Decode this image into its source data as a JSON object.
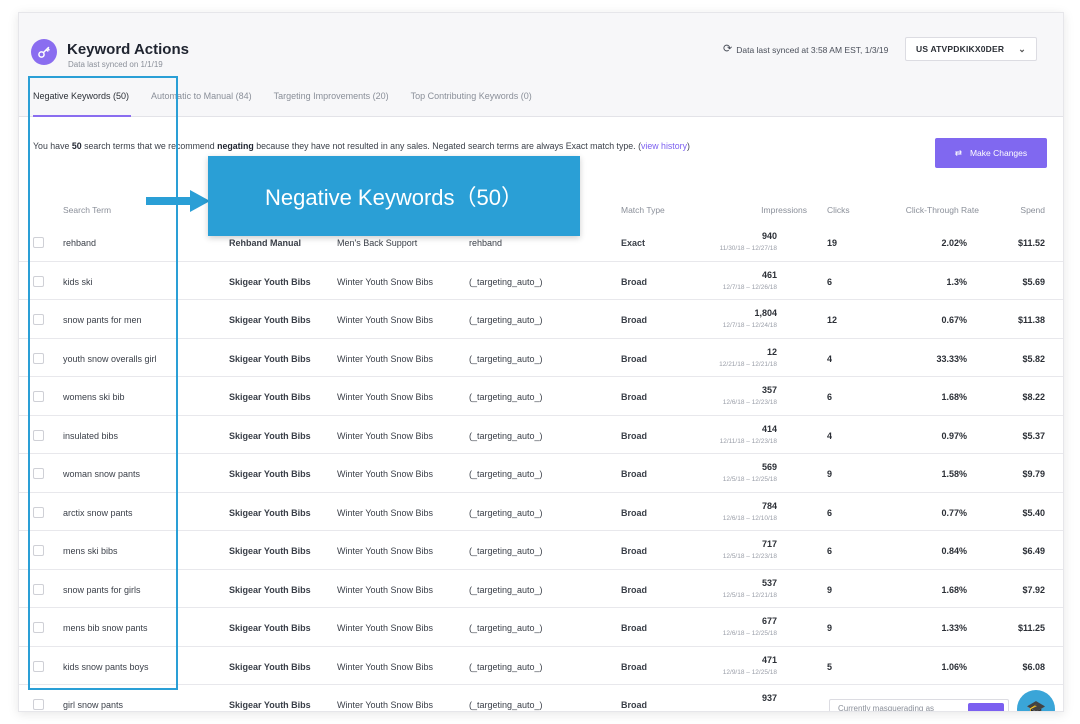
{
  "app": {
    "title": "Keyword Actions",
    "subtitle": "Data last synced on 1/1/19",
    "sync_text": "Data last synced at 3:58 AM EST, 1/3/19",
    "account": "US ATVPDKIKX0DER",
    "accent_color": "#8068f0"
  },
  "tabs": [
    {
      "label": "Negative Keywords (50)",
      "active": true
    },
    {
      "label": "Automatic to Manual (84)",
      "active": false
    },
    {
      "label": "Targeting Improvements (20)",
      "active": false
    },
    {
      "label": "Top Contributing Keywords (0)",
      "active": false
    }
  ],
  "info": {
    "pre": "You have",
    "count": "50",
    "mid": "search terms that we recommend",
    "keyword": "negating",
    "post": "because they have not resulted in any sales. Negated search terms are always Exact match type. (",
    "link": "view history",
    "close": ")"
  },
  "actions": {
    "make_changes": "Make Changes"
  },
  "table": {
    "headers": {
      "search_term": "Search Term",
      "match_type": "Match Type",
      "impressions": "Impressions",
      "clicks": "Clicks",
      "ctr": "Click-Through Rate",
      "spend": "Spend"
    },
    "rows": [
      {
        "term": "rehband",
        "product": "Rehband Manual",
        "campaign": "Men's Back Support",
        "ad_group": "rehband",
        "match": "Exact",
        "impressions": "940",
        "dates": "11/30/18 – 12/27/18",
        "clicks": "19",
        "ctr": "2.02%",
        "spend": "$11.52"
      },
      {
        "term": "kids ski",
        "product": "Skigear Youth Bibs",
        "campaign": "Winter Youth Snow Bibs",
        "ad_group": "(_targeting_auto_)",
        "match": "Broad",
        "impressions": "461",
        "dates": "12/7/18 – 12/26/18",
        "clicks": "6",
        "ctr": "1.3%",
        "spend": "$5.69"
      },
      {
        "term": "snow pants for men",
        "product": "Skigear Youth Bibs",
        "campaign": "Winter Youth Snow Bibs",
        "ad_group": "(_targeting_auto_)",
        "match": "Broad",
        "impressions": "1,804",
        "dates": "12/7/18 – 12/24/18",
        "clicks": "12",
        "ctr": "0.67%",
        "spend": "$11.38"
      },
      {
        "term": "youth snow overalls girl",
        "product": "Skigear Youth Bibs",
        "campaign": "Winter Youth Snow Bibs",
        "ad_group": "(_targeting_auto_)",
        "match": "Broad",
        "impressions": "12",
        "dates": "12/21/18 – 12/21/18",
        "clicks": "4",
        "ctr": "33.33%",
        "spend": "$5.82"
      },
      {
        "term": "womens ski bib",
        "product": "Skigear Youth Bibs",
        "campaign": "Winter Youth Snow Bibs",
        "ad_group": "(_targeting_auto_)",
        "match": "Broad",
        "impressions": "357",
        "dates": "12/6/18 – 12/23/18",
        "clicks": "6",
        "ctr": "1.68%",
        "spend": "$8.22"
      },
      {
        "term": "insulated bibs",
        "product": "Skigear Youth Bibs",
        "campaign": "Winter Youth Snow Bibs",
        "ad_group": "(_targeting_auto_)",
        "match": "Broad",
        "impressions": "414",
        "dates": "12/11/18 – 12/23/18",
        "clicks": "4",
        "ctr": "0.97%",
        "spend": "$5.37"
      },
      {
        "term": "woman snow pants",
        "product": "Skigear Youth Bibs",
        "campaign": "Winter Youth Snow Bibs",
        "ad_group": "(_targeting_auto_)",
        "match": "Broad",
        "impressions": "569",
        "dates": "12/5/18 – 12/25/18",
        "clicks": "9",
        "ctr": "1.58%",
        "spend": "$9.79"
      },
      {
        "term": "arctix snow pants",
        "product": "Skigear Youth Bibs",
        "campaign": "Winter Youth Snow Bibs",
        "ad_group": "(_targeting_auto_)",
        "match": "Broad",
        "impressions": "784",
        "dates": "12/6/18 – 12/10/18",
        "clicks": "6",
        "ctr": "0.77%",
        "spend": "$5.40"
      },
      {
        "term": "mens ski bibs",
        "product": "Skigear Youth Bibs",
        "campaign": "Winter Youth Snow Bibs",
        "ad_group": "(_targeting_auto_)",
        "match": "Broad",
        "impressions": "717",
        "dates": "12/5/18 – 12/23/18",
        "clicks": "6",
        "ctr": "0.84%",
        "spend": "$6.49"
      },
      {
        "term": "snow pants for girls",
        "product": "Skigear Youth Bibs",
        "campaign": "Winter Youth Snow Bibs",
        "ad_group": "(_targeting_auto_)",
        "match": "Broad",
        "impressions": "537",
        "dates": "12/5/18 – 12/21/18",
        "clicks": "9",
        "ctr": "1.68%",
        "spend": "$7.92"
      },
      {
        "term": "mens bib snow pants",
        "product": "Skigear Youth Bibs",
        "campaign": "Winter Youth Snow Bibs",
        "ad_group": "(_targeting_auto_)",
        "match": "Broad",
        "impressions": "677",
        "dates": "12/6/18 – 12/25/18",
        "clicks": "9",
        "ctr": "1.33%",
        "spend": "$11.25"
      },
      {
        "term": "kids snow pants boys",
        "product": "Skigear Youth Bibs",
        "campaign": "Winter Youth Snow Bibs",
        "ad_group": "(_targeting_auto_)",
        "match": "Broad",
        "impressions": "471",
        "dates": "12/9/18 – 12/25/18",
        "clicks": "5",
        "ctr": "1.06%",
        "spend": "$6.08"
      },
      {
        "term": "girl snow pants",
        "product": "Skigear Youth Bibs",
        "campaign": "Winter Youth Snow Bibs",
        "ad_group": "(_targeting_auto_)",
        "match": "Broad",
        "impressions": "937",
        "dates": "",
        "clicks": "",
        "ctr": "",
        "spend": ""
      }
    ]
  },
  "footer": {
    "masquerade": "Currently masquerading as"
  },
  "annotation": {
    "label": "Negative Keywords（50）",
    "color": "#2a9fd6"
  }
}
